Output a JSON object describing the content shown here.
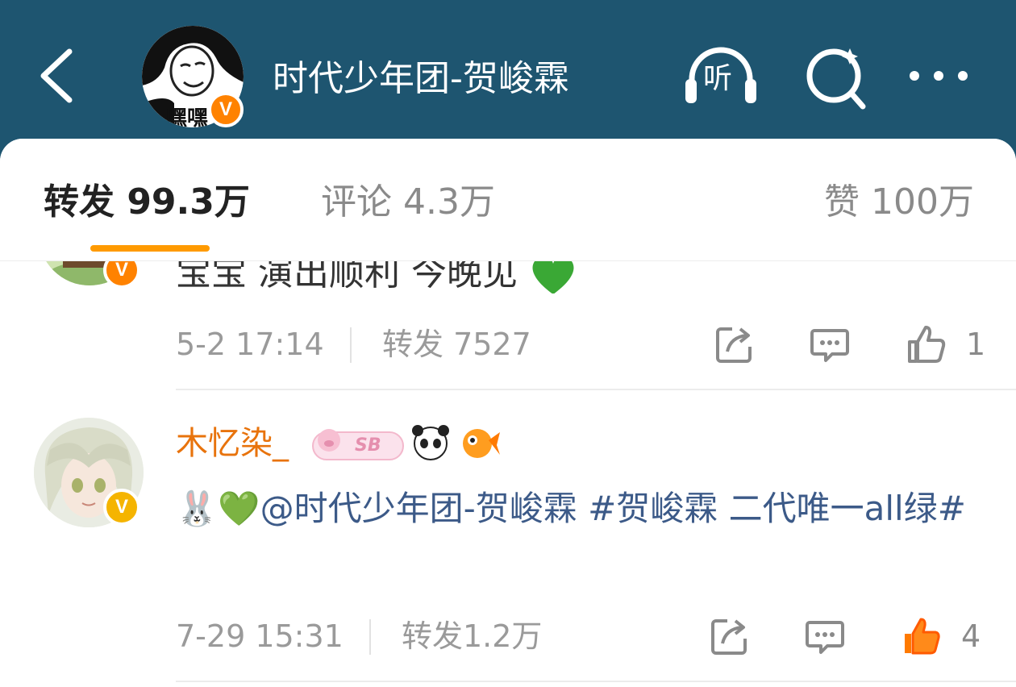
{
  "header": {
    "title": "时代少年团-贺峻霖",
    "avatar_caption": "嘿嘿",
    "verified_mark": "V",
    "listen_label": "听",
    "bg_color": "#1e5570"
  },
  "tabs": {
    "forward": "转发 99.3万",
    "comment": "评论 4.3万",
    "like": "赞 100万",
    "accent_color": "#ff9a00"
  },
  "items": [
    {
      "text": "宝宝 演出顺利 今晚见",
      "time": "5-2 17:14",
      "forwards": "转发 7527",
      "likes": "1",
      "verified_mark": "V"
    },
    {
      "username": "木忆染_",
      "badge_label": "SB",
      "text_emoji": "🐰💚",
      "mention": "@时代少年团-贺峻霖",
      "topic": "#贺峻霖 二代唯一all绿#",
      "time": "7-29 15:31",
      "forwards": "转发1.2万",
      "likes": "4",
      "verified_mark": "V"
    }
  ]
}
